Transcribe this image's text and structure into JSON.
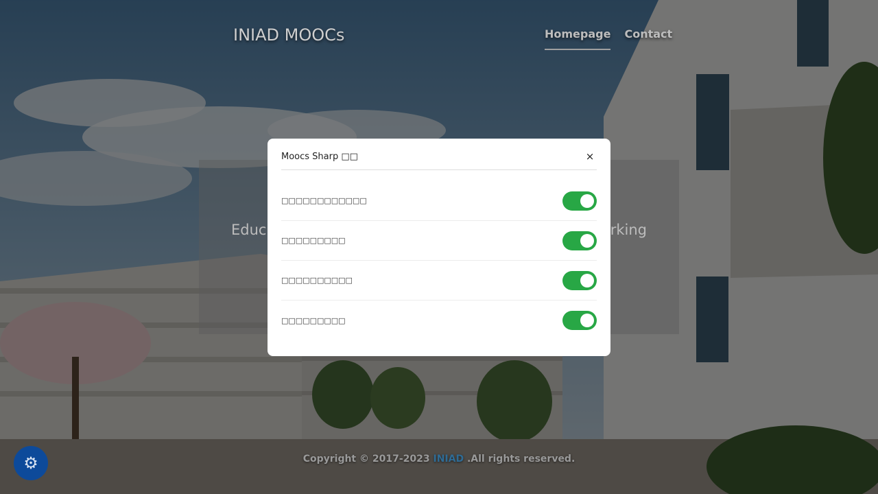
{
  "header": {
    "brand": "INIAD MOOCs",
    "nav": [
      {
        "label": "Homepage",
        "active": true
      },
      {
        "label": "Contact",
        "active": false
      }
    ]
  },
  "hero": {
    "text_left": "Educ",
    "text_right": "rking"
  },
  "footer": {
    "prefix": "Copyright © 2017-2023 ",
    "link": "INIAD",
    "suffix": " .All rights reserved."
  },
  "settings_button": {
    "icon": "gear-icon",
    "glyph": "⚙"
  },
  "modal": {
    "title": "Moocs Sharp □□",
    "close_glyph": "×",
    "options": [
      {
        "label": "□□□□□□□□□□□□",
        "enabled": true
      },
      {
        "label": "□□□□□□□□□",
        "enabled": true
      },
      {
        "label": "□□□□□□□□□□",
        "enabled": true
      },
      {
        "label": "□□□□□□□□□",
        "enabled": true
      }
    ]
  },
  "colors": {
    "toggle_on": "#28a745",
    "fab": "#0d4a9a",
    "link": "#2f6b94"
  }
}
